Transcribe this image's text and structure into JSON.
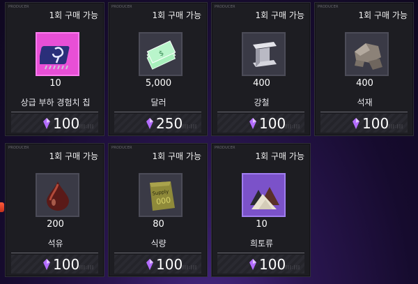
{
  "cards": [
    {
      "produce": "PRODUCER",
      "limit": "1회 구매 가능",
      "qty": "10",
      "name": "상급 부하 경험치 칩",
      "price": "100",
      "icon": "chip-icon"
    },
    {
      "produce": "PRODUCER",
      "limit": "1회 구매 가능",
      "qty": "5,000",
      "name": "달러",
      "price": "250",
      "icon": "dollar-bills-icon"
    },
    {
      "produce": "PRODUCER",
      "limit": "1회 구매 가능",
      "qty": "400",
      "name": "강철",
      "price": "100",
      "icon": "steel-beam-icon"
    },
    {
      "produce": "PRODUCER",
      "limit": "1회 구매 가능",
      "qty": "400",
      "name": "석재",
      "price": "100",
      "icon": "stone-icon"
    },
    {
      "produce": "PRODUCER",
      "limit": "1회 구매 가능",
      "qty": "200",
      "name": "석유",
      "price": "100",
      "icon": "oil-drop-icon"
    },
    {
      "produce": "PRODUCER",
      "limit": "1회 구매 가능",
      "qty": "80",
      "name": "식량",
      "price": "100",
      "icon": "supply-sack-icon"
    },
    {
      "produce": "PRODUCER",
      "limit": "1회 구매 가능",
      "qty": "10",
      "name": "희토류",
      "price": "100",
      "icon": "rare-earth-icon"
    }
  ],
  "colors": {
    "gem": "#b36cff",
    "accent_pink": "#e84fd6",
    "accent_purple": "#7b52c9"
  }
}
